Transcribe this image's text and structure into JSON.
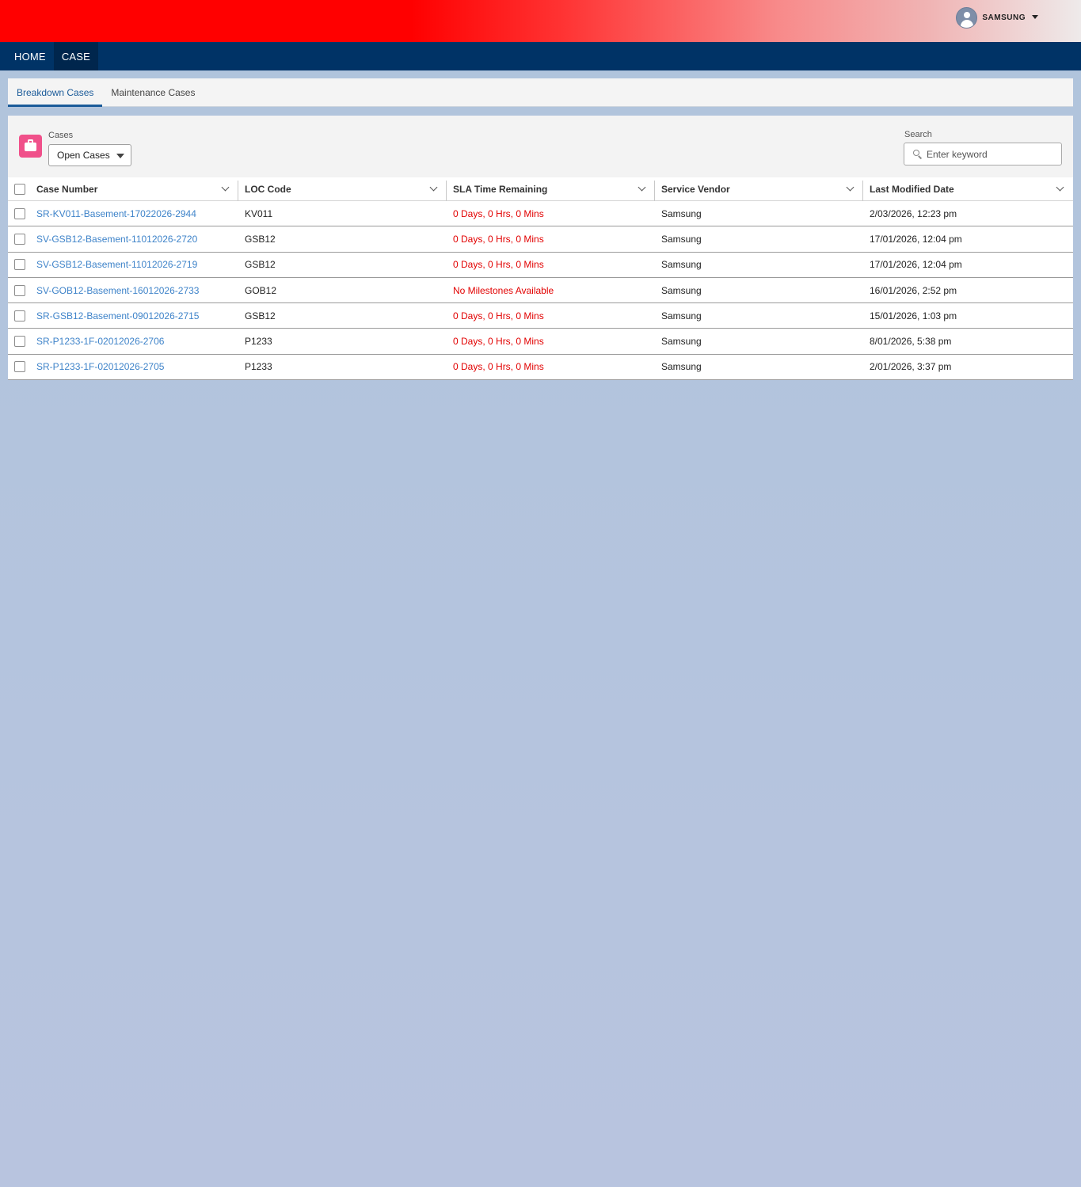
{
  "header": {
    "user_name": "SAMSUNG"
  },
  "nav": {
    "items": [
      {
        "label": "HOME"
      },
      {
        "label": "CASE"
      }
    ]
  },
  "tabs": [
    {
      "label": "Breakdown Cases"
    },
    {
      "label": "Maintenance Cases"
    }
  ],
  "list": {
    "filter_label": "Cases",
    "filter_value": "Open Cases",
    "search_label": "Search",
    "search_placeholder": "Enter keyword",
    "search_value": ""
  },
  "table": {
    "columns": [
      {
        "label": "Case Number"
      },
      {
        "label": "LOC Code"
      },
      {
        "label": "SLA Time Remaining"
      },
      {
        "label": "Service Vendor"
      },
      {
        "label": "Last Modified Date"
      }
    ],
    "rows": [
      {
        "case": "SR-KV011-Basement-17022026-2944",
        "loc": "KV011",
        "sla": "0 Days, 0 Hrs, 0 Mins",
        "vendor": "Samsung",
        "modified": "2/03/2026, 12:23 pm"
      },
      {
        "case": "SV-GSB12-Basement-11012026-2720",
        "loc": "GSB12",
        "sla": "0 Days, 0 Hrs, 0 Mins",
        "vendor": "Samsung",
        "modified": "17/01/2026, 12:04 pm"
      },
      {
        "case": "SV-GSB12-Basement-11012026-2719",
        "loc": "GSB12",
        "sla": "0 Days, 0 Hrs, 0 Mins",
        "vendor": "Samsung",
        "modified": "17/01/2026, 12:04 pm"
      },
      {
        "case": "SV-GOB12-Basement-16012026-2733",
        "loc": "GOB12",
        "sla": "No Milestones Available",
        "vendor": "Samsung",
        "modified": "16/01/2026, 2:52 pm"
      },
      {
        "case": "SR-GSB12-Basement-09012026-2715",
        "loc": "GSB12",
        "sla": "0 Days, 0 Hrs, 0 Mins",
        "vendor": "Samsung",
        "modified": "15/01/2026, 1:03 pm"
      },
      {
        "case": "SR-P1233-1F-02012026-2706",
        "loc": "P1233",
        "sla": "0 Days, 0 Hrs, 0 Mins",
        "vendor": "Samsung",
        "modified": "8/01/2026, 5:38 pm"
      },
      {
        "case": "SR-P1233-1F-02012026-2705",
        "loc": "P1233",
        "sla": "0 Days, 0 Hrs, 0 Mins",
        "vendor": "Samsung",
        "modified": "2/01/2026, 3:37 pm"
      }
    ]
  },
  "colors": {
    "nav_bg": "#003366",
    "accent_tab": "#1b5b99",
    "link": "#3e83c9",
    "sla_alert": "#e20000",
    "case_icon": "#f0508a"
  }
}
